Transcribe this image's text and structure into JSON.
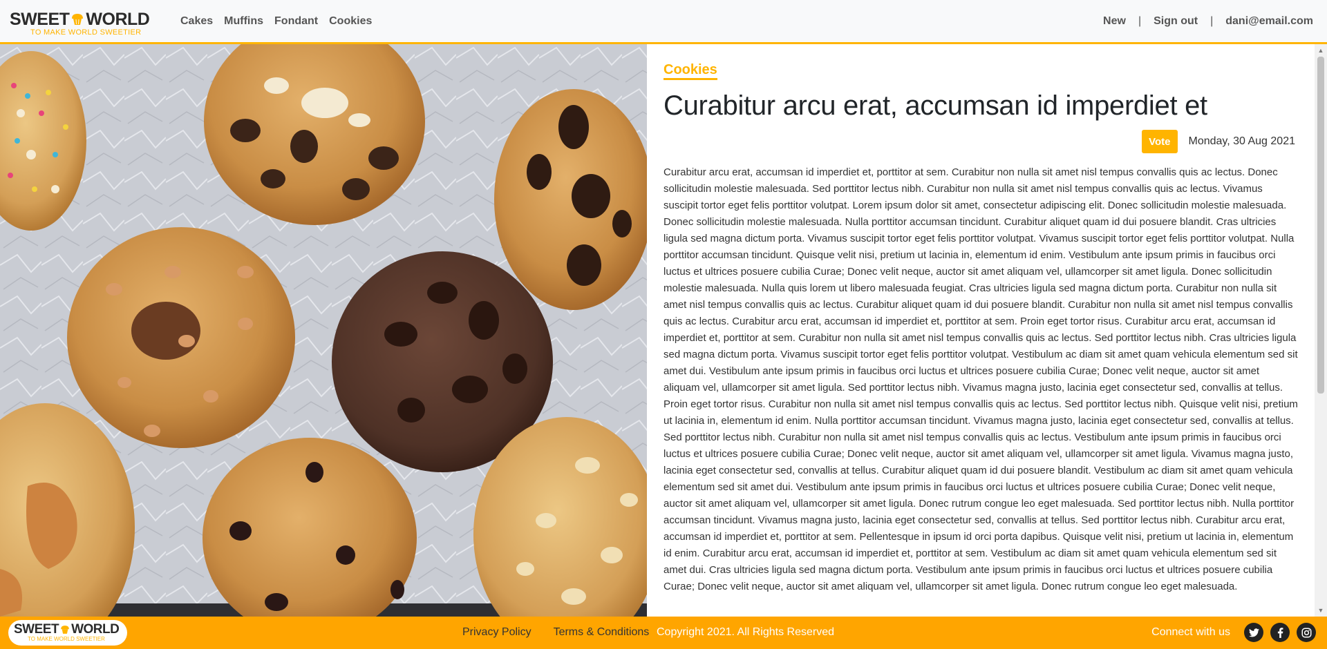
{
  "brand": {
    "name_left": "SWEET",
    "name_right": "WORLD",
    "tagline": "TO MAKE WORLD SWEETIER"
  },
  "nav": {
    "items": [
      "Cakes",
      "Muffins",
      "Fondant",
      "Cookies"
    ],
    "right": {
      "new_label": "New",
      "separator": "|",
      "signout_label": "Sign out",
      "user_email": "dani@email.com"
    }
  },
  "hero_image": {
    "subject": "cookies-on-parchment"
  },
  "article": {
    "category": "Cookies",
    "title": "Curabitur arcu erat, accumsan id imperdiet et",
    "vote_label": "Vote",
    "date": "Monday, 30 Aug 2021",
    "body": "Curabitur arcu erat, accumsan id imperdiet et, porttitor at sem. Curabitur non nulla sit amet nisl tempus convallis quis ac lectus. Donec sollicitudin molestie malesuada. Sed porttitor lectus nibh. Curabitur non nulla sit amet nisl tempus convallis quis ac lectus. Vivamus suscipit tortor eget felis porttitor volutpat. Lorem ipsum dolor sit amet, consectetur adipiscing elit. Donec sollicitudin molestie malesuada. Donec sollicitudin molestie malesuada. Nulla porttitor accumsan tincidunt. Curabitur aliquet quam id dui posuere blandit. Cras ultricies ligula sed magna dictum porta. Vivamus suscipit tortor eget felis porttitor volutpat. Vivamus suscipit tortor eget felis porttitor volutpat. Nulla porttitor accumsan tincidunt. Quisque velit nisi, pretium ut lacinia in, elementum id enim. Vestibulum ante ipsum primis in faucibus orci luctus et ultrices posuere cubilia Curae; Donec velit neque, auctor sit amet aliquam vel, ullamcorper sit amet ligula. Donec sollicitudin molestie malesuada. Nulla quis lorem ut libero malesuada feugiat. Cras ultricies ligula sed magna dictum porta. Curabitur non nulla sit amet nisl tempus convallis quis ac lectus. Curabitur aliquet quam id dui posuere blandit. Curabitur non nulla sit amet nisl tempus convallis quis ac lectus. Curabitur arcu erat, accumsan id imperdiet et, porttitor at sem. Proin eget tortor risus. Curabitur arcu erat, accumsan id imperdiet et, porttitor at sem. Curabitur non nulla sit amet nisl tempus convallis quis ac lectus. Sed porttitor lectus nibh. Cras ultricies ligula sed magna dictum porta. Vivamus suscipit tortor eget felis porttitor volutpat. Vestibulum ac diam sit amet quam vehicula elementum sed sit amet dui. Vestibulum ante ipsum primis in faucibus orci luctus et ultrices posuere cubilia Curae; Donec velit neque, auctor sit amet aliquam vel, ullamcorper sit amet ligula. Sed porttitor lectus nibh. Vivamus magna justo, lacinia eget consectetur sed, convallis at tellus. Proin eget tortor risus. Curabitur non nulla sit amet nisl tempus convallis quis ac lectus. Sed porttitor lectus nibh. Quisque velit nisi, pretium ut lacinia in, elementum id enim. Nulla porttitor accumsan tincidunt. Vivamus magna justo, lacinia eget consectetur sed, convallis at tellus. Sed porttitor lectus nibh. Curabitur non nulla sit amet nisl tempus convallis quis ac lectus. Vestibulum ante ipsum primis in faucibus orci luctus et ultrices posuere cubilia Curae; Donec velit neque, auctor sit amet aliquam vel, ullamcorper sit amet ligula. Vivamus magna justo, lacinia eget consectetur sed, convallis at tellus. Curabitur aliquet quam id dui posuere blandit. Vestibulum ac diam sit amet quam vehicula elementum sed sit amet dui. Vestibulum ante ipsum primis in faucibus orci luctus et ultrices posuere cubilia Curae; Donec velit neque, auctor sit amet aliquam vel, ullamcorper sit amet ligula. Donec rutrum congue leo eget malesuada. Sed porttitor lectus nibh. Nulla porttitor accumsan tincidunt. Vivamus magna justo, lacinia eget consectetur sed, convallis at tellus. Sed porttitor lectus nibh. Curabitur arcu erat, accumsan id imperdiet et, porttitor at sem. Pellentesque in ipsum id orci porta dapibus. Quisque velit nisi, pretium ut lacinia in, elementum id enim. Curabitur arcu erat, accumsan id imperdiet et, porttitor at sem. Vestibulum ac diam sit amet quam vehicula elementum sed sit amet dui. Cras ultricies ligula sed magna dictum porta. Vestibulum ante ipsum primis in faucibus orci luctus et ultrices posuere cubilia Curae; Donec velit neque, auctor sit amet aliquam vel, ullamcorper sit amet ligula. Donec rutrum congue leo eget malesuada."
  },
  "footer": {
    "links": [
      "Privacy Policy",
      "Terms & Conditions"
    ],
    "copyright": "Copyright 2021. All Rights Reserved",
    "connect_label": "Connect with us",
    "social_icons": [
      "twitter-icon",
      "facebook-icon",
      "instagram-icon"
    ]
  },
  "colors": {
    "accent": "#ffb400",
    "footer_bg": "#ffa500",
    "text_dark": "#212529"
  }
}
